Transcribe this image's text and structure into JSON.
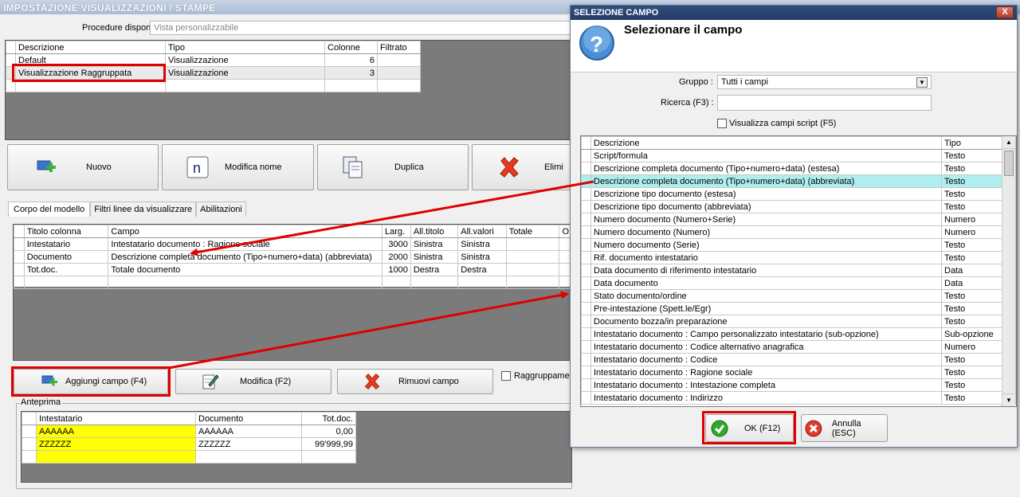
{
  "main": {
    "title": "IMPOSTAZIONE VISUALIZZAZIONI / STAMPE",
    "procedure_label": "Procedure disponibili :",
    "procedure_placeholder": "Vista personalizzabile",
    "views_headers": [
      "Descrizione",
      "Tipo",
      "Colonne",
      "Filtrato"
    ],
    "views_rows": [
      {
        "descrizione": "Default",
        "tipo": "Visualizzazione",
        "colonne": "6",
        "filtrato": ""
      },
      {
        "descrizione": "Visualizzazione Raggruppata",
        "tipo": "Visualizzazione",
        "colonne": "3",
        "filtrato": ""
      }
    ],
    "buttons": {
      "nuovo": "Nuovo",
      "modifica_nome": "Modifica nome",
      "duplica": "Duplica",
      "elimina": "Elimi"
    },
    "tabs": [
      "Corpo del modello",
      "Filtri linee da visualizzare",
      "Abilitazioni"
    ],
    "columns_headers": [
      "Titolo colonna",
      "Campo",
      "Larg.",
      "All.titolo",
      "All.valori",
      "Totale",
      "O"
    ],
    "columns_rows": [
      {
        "titolo": "Intestatario",
        "campo": "Intestatario documento : Ragione sociale",
        "larg": "3000",
        "all_titolo": "Sinistra",
        "all_valori": "Sinistra",
        "totale": ""
      },
      {
        "titolo": "Documento",
        "campo": "Descrizione completa documento (Tipo+numero+data) (abbreviata)",
        "larg": "2000",
        "all_titolo": "Sinistra",
        "all_valori": "Sinistra",
        "totale": ""
      },
      {
        "titolo": "Tot.doc.",
        "campo": "Totale documento",
        "larg": "1000",
        "all_titolo": "Destra",
        "all_valori": "Destra",
        "totale": ""
      }
    ],
    "aggiungi_label": "Aggiungi campo (F4)",
    "modifica_label": "Modifica (F2)",
    "rimuovi_label": "Rimuovi campo",
    "raggruppamento_label": "Raggruppamen",
    "anteprima_label": "Anteprima",
    "preview_headers": [
      "Intestatario",
      "Documento",
      "Tot.doc."
    ],
    "preview_rows": [
      {
        "intestatario": "AAAAAA",
        "documento": "AAAAAA",
        "totdoc": "0,00"
      },
      {
        "intestatario": "ZZZZZZ",
        "documento": "ZZZZZZ",
        "totdoc": "99'999,99"
      }
    ]
  },
  "dialog": {
    "title": "SELEZIONE CAMPO",
    "close": "X",
    "heading": "Selezionare il campo",
    "gruppo_label": "Gruppo :",
    "gruppo_value": "Tutti i campi",
    "ricerca_label": "Ricerca (F3) :",
    "ricerca_value": "",
    "script_label": "Visualizza campi script (F5)",
    "headers": [
      "Descrizione",
      "Tipo"
    ],
    "rows": [
      {
        "descrizione": "Script/formula",
        "tipo": "Testo"
      },
      {
        "descrizione": "Descrizione completa documento (Tipo+numero+data) (estesa)",
        "tipo": "Testo"
      },
      {
        "descrizione": "Descrizione completa documento (Tipo+numero+data) (abbreviata)",
        "tipo": "Testo"
      },
      {
        "descrizione": "Descrizione tipo documento (estesa)",
        "tipo": "Testo"
      },
      {
        "descrizione": "Descrizione tipo documento (abbreviata)",
        "tipo": "Testo"
      },
      {
        "descrizione": "Numero documento (Numero+Serie)",
        "tipo": "Numero"
      },
      {
        "descrizione": "Numero documento (Numero)",
        "tipo": "Numero"
      },
      {
        "descrizione": "Numero documento (Serie)",
        "tipo": "Testo"
      },
      {
        "descrizione": "Rif. documento intestatario",
        "tipo": "Testo"
      },
      {
        "descrizione": "Data documento di riferimento intestatario",
        "tipo": "Data"
      },
      {
        "descrizione": "Data documento",
        "tipo": "Data"
      },
      {
        "descrizione": "Stato documento/ordine",
        "tipo": "Testo"
      },
      {
        "descrizione": "Pre-intestazione (Spett.le/Egr)",
        "tipo": "Testo"
      },
      {
        "descrizione": "Documento bozza/in preparazione",
        "tipo": "Testo"
      },
      {
        "descrizione": "Intestatario documento : Campo personalizzato intestatario (sub-opzione)",
        "tipo": "Sub-opzione"
      },
      {
        "descrizione": "Intestatario documento : Codice alternativo anagrafica",
        "tipo": "Numero"
      },
      {
        "descrizione": "Intestatario documento : Codice",
        "tipo": "Testo"
      },
      {
        "descrizione": "Intestatario documento : Ragione sociale",
        "tipo": "Testo"
      },
      {
        "descrizione": "Intestatario documento : Intestazione completa",
        "tipo": "Testo"
      },
      {
        "descrizione": "Intestatario documento : Indirizzo",
        "tipo": "Testo"
      }
    ],
    "ok_label": "OK (F12)",
    "annulla_label": "Annulla (ESC)"
  }
}
